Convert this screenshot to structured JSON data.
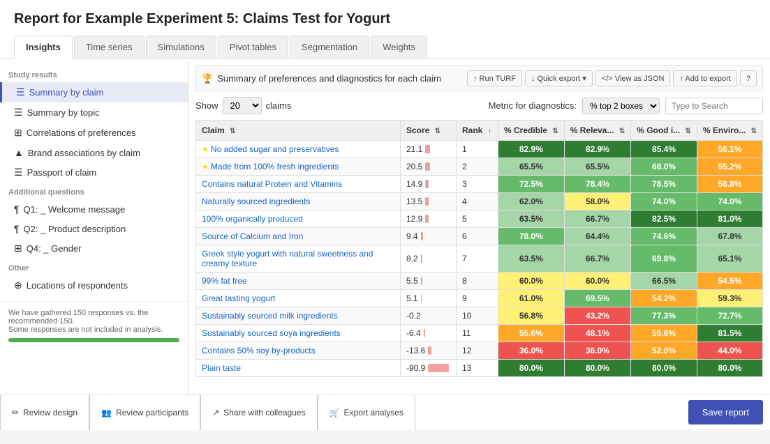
{
  "header": {
    "title": "Report for Example Experiment 5: Claims Test for Yogurt"
  },
  "tabs": [
    {
      "label": "Insights",
      "active": true
    },
    {
      "label": "Time series",
      "active": false
    },
    {
      "label": "Simulations",
      "active": false
    },
    {
      "label": "Pivot tables",
      "active": false
    },
    {
      "label": "Segmentation",
      "active": false
    },
    {
      "label": "Weights",
      "active": false
    }
  ],
  "sidebar": {
    "study_results_label": "Study results",
    "items": [
      {
        "label": "Summary by claim",
        "active": true,
        "icon": "☰"
      },
      {
        "label": "Summary by topic",
        "active": false,
        "icon": "☰"
      },
      {
        "label": "Correlations of preferences",
        "active": false,
        "icon": "⊞"
      },
      {
        "label": "Brand associations by claim",
        "active": false,
        "icon": "▲"
      },
      {
        "label": "Passport of claim",
        "active": false,
        "icon": "☰"
      }
    ],
    "additional_questions_label": "Additional questions",
    "additional_items": [
      {
        "label": "Q1: _ Welcome message",
        "icon": "¶"
      },
      {
        "label": "Q2: _ Product description",
        "icon": "¶"
      },
      {
        "label": "Q4: _ Gender",
        "icon": "⊞"
      }
    ],
    "other_label": "Other",
    "other_items": [
      {
        "label": "Locations of respondents",
        "icon": "⊕"
      }
    ],
    "bottom_text1": "We have gathered 150 responses vs. the recommended 150.",
    "bottom_text2": "Some responses are not included in analysis."
  },
  "content": {
    "toolbar": {
      "title": "Summary of preferences and diagnostics for each claim",
      "title_icon": "🏆",
      "btn_run_turf": "↑ Run TURF",
      "btn_quick_export": "↓ Quick export ▾",
      "btn_view_json": "</> View as JSON",
      "btn_add_to_export": "↑ Add to export",
      "btn_help": "?"
    },
    "controls": {
      "show_label": "Show",
      "show_value": "20",
      "claims_label": "claims",
      "metric_label": "Metric for diagnostics:",
      "metric_value": "% top 2 boxes",
      "search_placeholder": "Type to Search"
    },
    "table": {
      "columns": [
        "Claim",
        "Score",
        "Rank",
        "% Credible",
        "% Releva...",
        "% Good i...",
        "% Enviro..."
      ],
      "rows": [
        {
          "claim": "No added sugar and preservatives",
          "score": 21.1,
          "rank": 1,
          "credible": "82.9%",
          "relevance": "82.9%",
          "good": "85.4%",
          "enviro": "56.1%",
          "credible_color": "green-dark",
          "relevance_color": "green-dark",
          "good_color": "green-dark",
          "enviro_color": "orange",
          "starred": true
        },
        {
          "claim": "Made from 100% fresh ingredients",
          "score": 20.5,
          "rank": 2,
          "credible": "65.5%",
          "relevance": "65.5%",
          "good": "68.0%",
          "enviro": "55.2%",
          "credible_color": "green-light",
          "relevance_color": "green-light",
          "good_color": "green-med",
          "enviro_color": "orange",
          "starred": true
        },
        {
          "claim": "Contains natural Protein and Vitamins",
          "score": 14.9,
          "rank": 3,
          "credible": "72.5%",
          "relevance": "78.4%",
          "good": "78.5%",
          "enviro": "58.8%",
          "credible_color": "green-med",
          "relevance_color": "green-med",
          "good_color": "green-med",
          "enviro_color": "orange"
        },
        {
          "claim": "Naturally sourced ingredients",
          "score": 13.5,
          "rank": 4,
          "credible": "62.0%",
          "relevance": "58.0%",
          "good": "74.0%",
          "enviro": "74.0%",
          "credible_color": "green-light",
          "relevance_color": "yellow",
          "good_color": "green-med",
          "enviro_color": "green-med"
        },
        {
          "claim": "100% organically produced",
          "score": 12.9,
          "rank": 5,
          "credible": "63.5%",
          "relevance": "66.7%",
          "good": "82.5%",
          "enviro": "81.0%",
          "credible_color": "green-light",
          "relevance_color": "green-light",
          "good_color": "green-dark",
          "enviro_color": "green-dark"
        },
        {
          "claim": "Source of Calcium and Iron",
          "score": 9.4,
          "rank": 6,
          "credible": "78.0%",
          "relevance": "64.4%",
          "good": "74.6%",
          "enviro": "67.8%",
          "credible_color": "green-med",
          "relevance_color": "green-light",
          "good_color": "green-med",
          "enviro_color": "green-light"
        },
        {
          "claim": "Greek style yogurt with natural sweetness and creamy texture",
          "score": 8.2,
          "rank": 7,
          "credible": "63.5%",
          "relevance": "66.7%",
          "good": "69.8%",
          "enviro": "65.1%",
          "credible_color": "green-light",
          "relevance_color": "green-light",
          "good_color": "green-med",
          "enviro_color": "green-light"
        },
        {
          "claim": "99% fat free",
          "score": 5.5,
          "rank": 8,
          "credible": "60.0%",
          "relevance": "60.0%",
          "good": "66.5%",
          "enviro": "54.5%",
          "credible_color": "yellow",
          "relevance_color": "yellow",
          "good_color": "green-light",
          "enviro_color": "orange"
        },
        {
          "claim": "Great tasting yogurt",
          "score": 5.1,
          "rank": 9,
          "credible": "61.0%",
          "relevance": "69.5%",
          "good": "54.2%",
          "enviro": "59.3%",
          "credible_color": "yellow",
          "relevance_color": "green-med",
          "good_color": "orange",
          "enviro_color": "yellow"
        },
        {
          "claim": "Sustainably sourced milk ingredients",
          "score": -0.2,
          "rank": 10,
          "credible": "56.8%",
          "relevance": "43.2%",
          "good": "77.3%",
          "enviro": "72.7%",
          "credible_color": "yellow",
          "relevance_color": "red",
          "good_color": "green-med",
          "enviro_color": "green-med"
        },
        {
          "claim": "Sustainably sourced soya ingredients",
          "score": -6.4,
          "rank": 11,
          "credible": "55.6%",
          "relevance": "48.1%",
          "good": "55.6%",
          "enviro": "81.5%",
          "credible_color": "orange",
          "relevance_color": "red",
          "good_color": "orange",
          "enviro_color": "green-dark"
        },
        {
          "claim": "Contains 50% soy by-products",
          "score": -13.6,
          "rank": 12,
          "credible": "36.0%",
          "relevance": "36.0%",
          "good": "52.0%",
          "enviro": "44.0%",
          "credible_color": "red",
          "relevance_color": "red",
          "good_color": "orange",
          "enviro_color": "red"
        },
        {
          "claim": "Plain taste",
          "score": -90.9,
          "rank": 13,
          "credible": "80.0%",
          "relevance": "80.0%",
          "good": "80.0%",
          "enviro": "80.0%",
          "credible_color": "green-dark",
          "relevance_color": "green-dark",
          "good_color": "green-dark",
          "enviro_color": "green-dark"
        }
      ]
    }
  },
  "footer": {
    "btn_review_design": "Review design",
    "btn_review_participants": "Review participants",
    "btn_share_colleagues": "Share with colleagues",
    "btn_export_analyses": "Export analyses",
    "btn_save_report": "Save report"
  }
}
